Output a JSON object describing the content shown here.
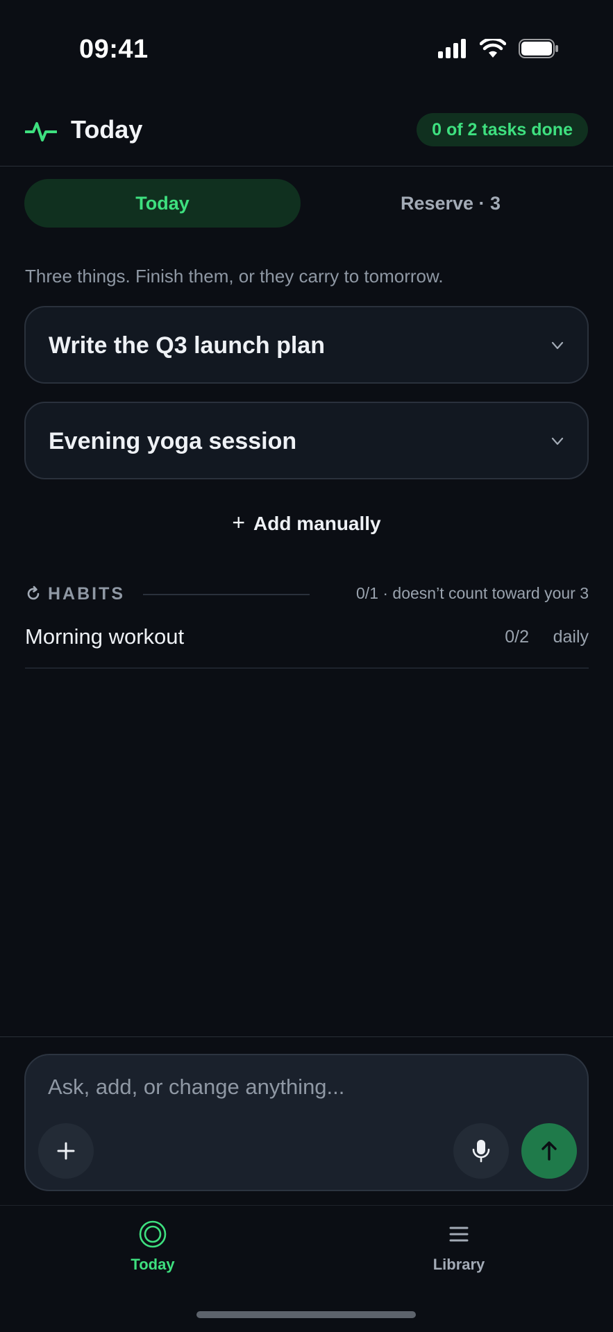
{
  "status_bar": {
    "time": "09:41"
  },
  "header": {
    "title": "Today",
    "progress_badge": "0 of 2 tasks done",
    "icon": "pulse-icon",
    "accent_color": "#3ee07f"
  },
  "tabs": [
    {
      "label": "Today",
      "selected": true
    },
    {
      "label": "Reserve · 3",
      "selected": false
    }
  ],
  "subtitle": "Three things. Finish them, or they carry to tomorrow.",
  "tasks": [
    {
      "title": "Write the Q3 launch plan"
    },
    {
      "title": "Evening yoga session"
    }
  ],
  "add_manually": {
    "plus": "+",
    "label": "Add manually"
  },
  "habits": {
    "label": "HABITS",
    "note": "0/1 · doesn’t count toward your 3",
    "items": [
      {
        "name": "Morning workout",
        "count": "0/2",
        "frequency": "daily"
      }
    ]
  },
  "composer": {
    "placeholder": "Ask, add, or change anything..."
  },
  "bottom_nav": [
    {
      "label": "Today",
      "icon": "target-circle-icon",
      "active": true
    },
    {
      "label": "Library",
      "icon": "list-icon",
      "active": false
    }
  ]
}
